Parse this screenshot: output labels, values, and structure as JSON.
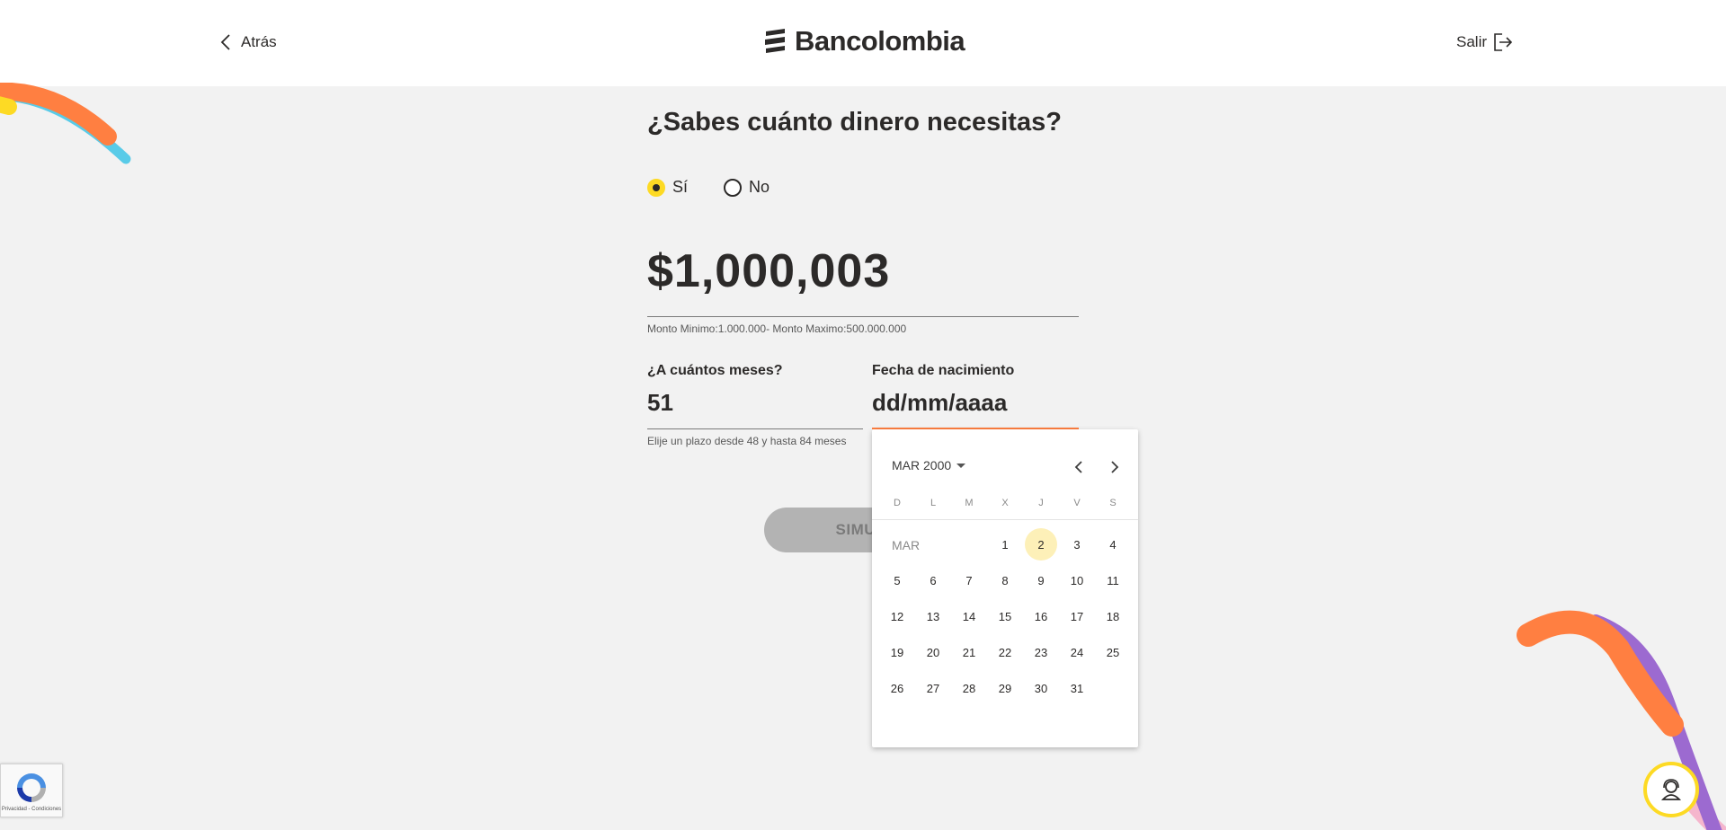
{
  "header": {
    "back_label": "Atrás",
    "logo_text": "Bancolombia",
    "exit_label": "Salir"
  },
  "form": {
    "question": "¿Sabes cuánto dinero necesitas?",
    "radio_yes": "Sí",
    "radio_no": "No",
    "radio_selected": "Sí",
    "amount": "$1,000,003",
    "amount_hint": "Monto Minimo:1.000.000- Monto Maximo:500.000.000",
    "months_label": "¿A cuántos meses?",
    "months_value": "51",
    "months_hint": "Elije un plazo desde 48 y hasta 84 meses",
    "birth_label": "Fecha de nacimiento",
    "birth_placeholder": "dd/mm/aaaa",
    "simulate_label": "SIMULAR"
  },
  "datepicker": {
    "month_year": "MAR 2000",
    "month_short": "MAR",
    "weekdays": [
      "D",
      "L",
      "M",
      "X",
      "J",
      "V",
      "S"
    ],
    "selected_day": "2",
    "weeks": [
      [
        "",
        "",
        "",
        "1",
        "2",
        "3",
        "4"
      ],
      [
        "5",
        "6",
        "7",
        "8",
        "9",
        "10",
        "11"
      ],
      [
        "12",
        "13",
        "14",
        "15",
        "16",
        "17",
        "18"
      ],
      [
        "19",
        "20",
        "21",
        "22",
        "23",
        "24",
        "25"
      ],
      [
        "26",
        "27",
        "28",
        "29",
        "30",
        "31",
        ""
      ]
    ]
  },
  "recaptcha": {
    "terms": "Privacidad - Condiciones"
  },
  "colors": {
    "brand_yellow": "#fdda24",
    "accent_orange": "#ff7f41",
    "deco_blue": "#59cbe8",
    "deco_purple": "#9c6ad0",
    "deco_pink": "#f5b6cd",
    "selected_day_bg": "#fdf0b8"
  },
  "icons": {
    "back": "chevron-left-icon",
    "exit": "logout-icon",
    "prev": "chevron-left-icon",
    "next": "chevron-right-icon",
    "help": "support-agent-icon",
    "captcha": "recaptcha-icon"
  }
}
